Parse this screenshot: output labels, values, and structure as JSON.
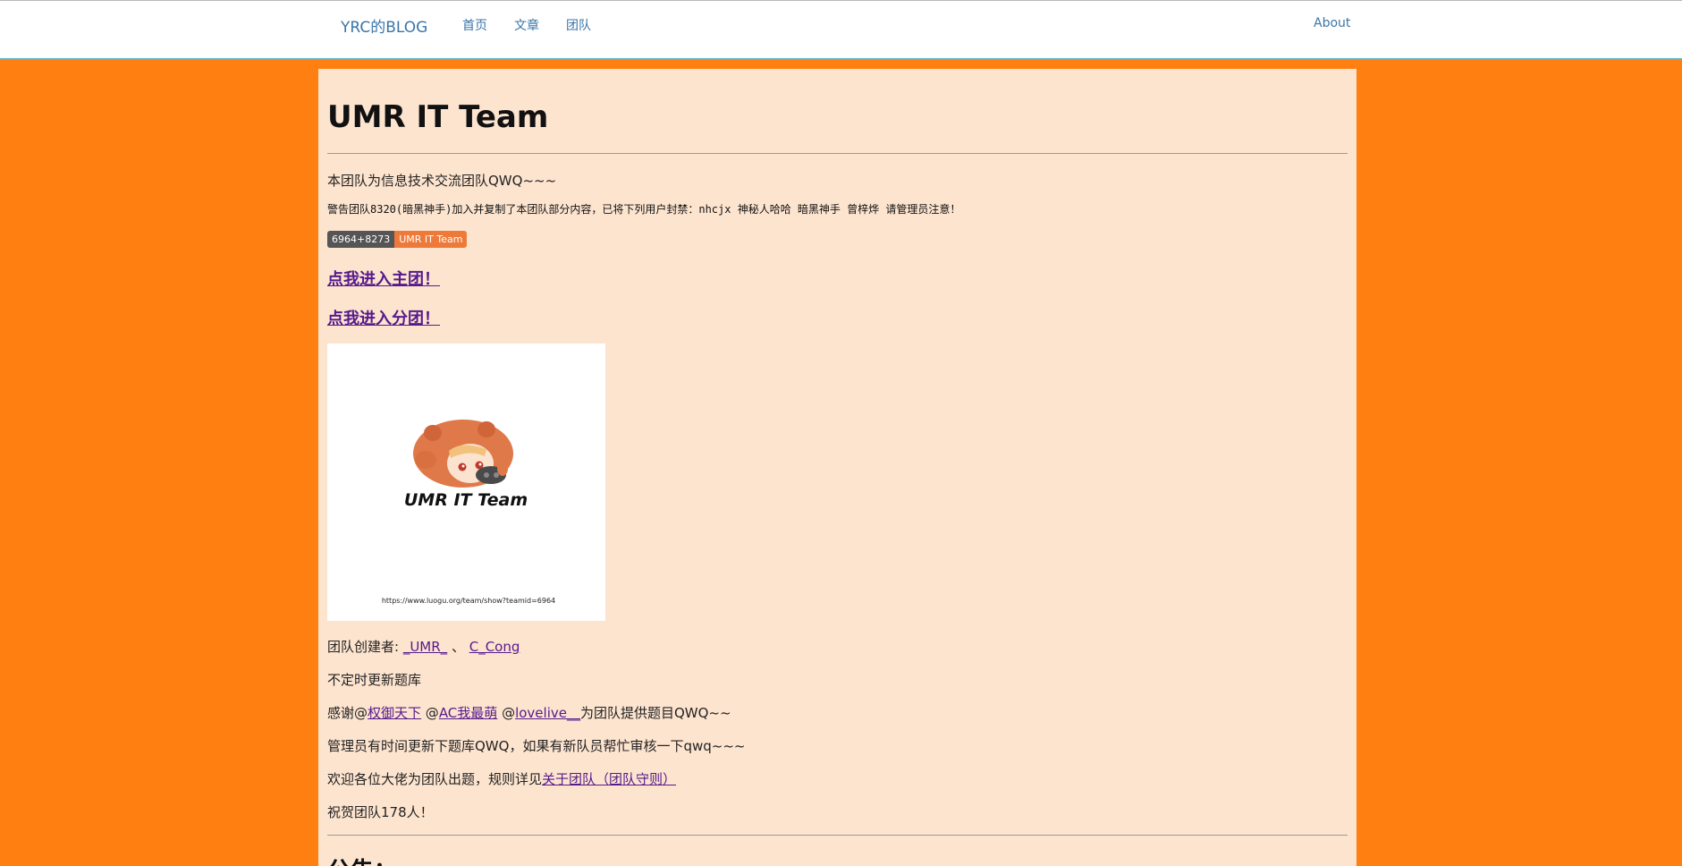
{
  "navbar": {
    "brand": "YRC的BLOG",
    "links": [
      "首页",
      "文章",
      "团队"
    ],
    "about": "About"
  },
  "team": {
    "title": "UMR IT Team",
    "intro": "本团队为信息技术交流团队QWQ~~~",
    "warning": "警告团队8320(暗黑神手)加入并复制了本团队部分内容，已将下列用户封禁：nhcjx 神秘人哈哈 暗黑神手 曾梓烨 请管理员注意！",
    "badge_left": "6964+8273",
    "badge_right": "UMR IT Team",
    "link_main": "点我进入主团！",
    "link_sub": "点我进入分团！",
    "logo_text": "UMR IT Team",
    "logo_url": "https://www.luogu.org/team/show?teamid=6964",
    "creator_label": "团队创建者: ",
    "creator_1": "_UMR_",
    "creator_sep": " 、 ",
    "creator_2": "C_Cong",
    "update": "不定时更新题库",
    "thanks_prefix": "感谢@",
    "thanks_user1": "权御天下",
    "thanks_at2": " @",
    "thanks_user2": "AC我最萌",
    "thanks_at3": " @",
    "thanks_user3": "lovelive__",
    "thanks_suffix": "为团队提供题目QWQ~~",
    "admin_note": "管理员有时间更新下题库QWQ，如果有新队员帮忙审核一下qwq~~~",
    "welcome_prefix": "欢迎各位大佬为团队出题，规则详见",
    "welcome_link": "关于团队（团队守则）",
    "congrats": "祝贺团队178人！",
    "notice_heading": "公告："
  },
  "colors": {
    "background": "#ff7f10",
    "content_bg": "#fde4cf",
    "link": "#551a8b",
    "nav_link": "#3a76a8",
    "nav_border": "#5bb8c9"
  }
}
